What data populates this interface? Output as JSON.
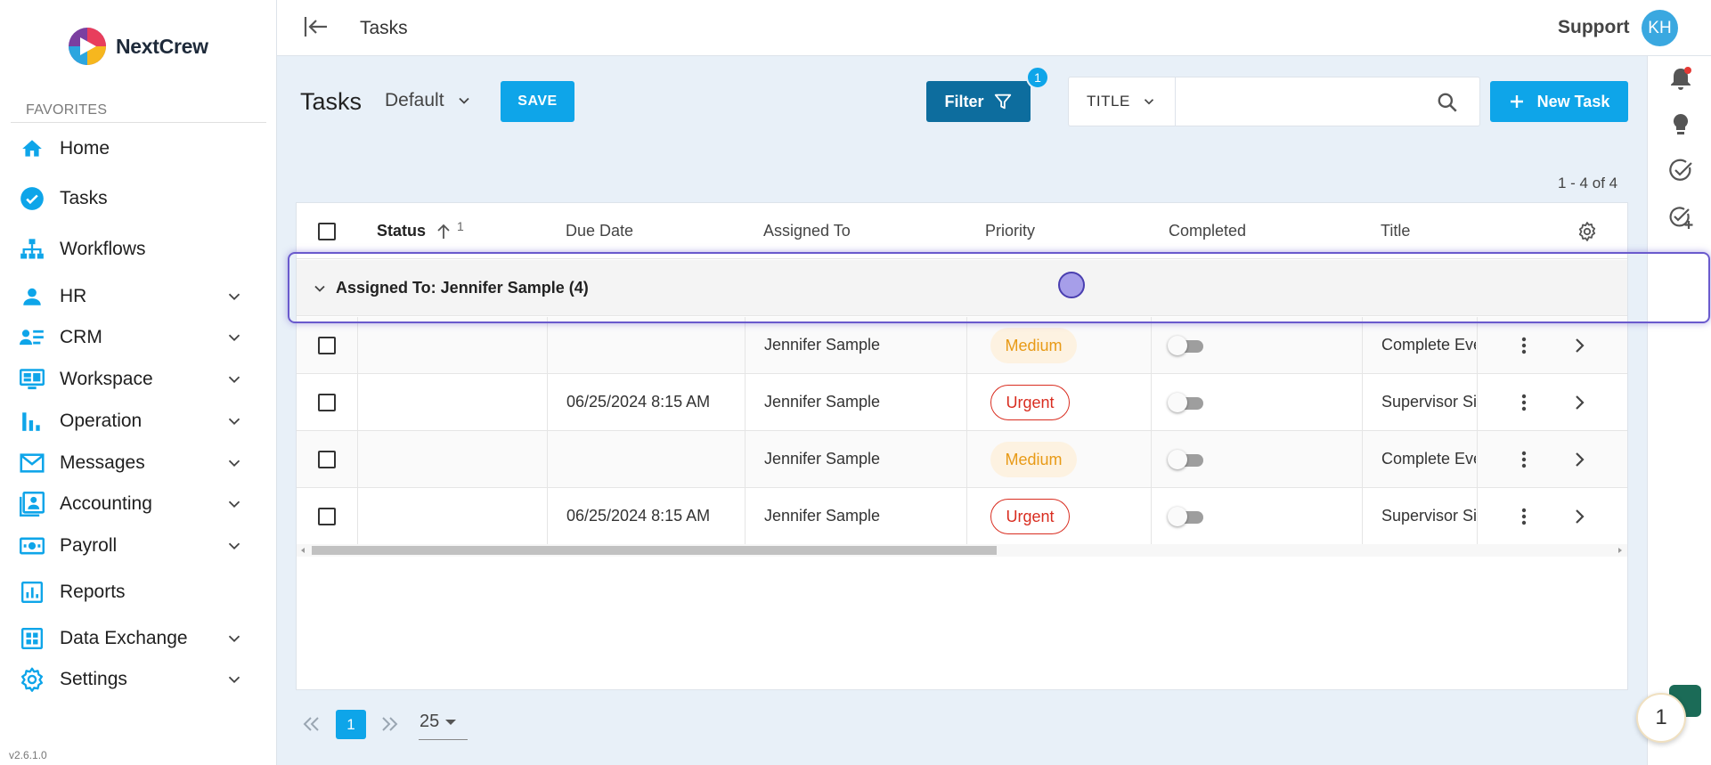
{
  "brand": {
    "name": "NextCrew",
    "version": "v2.6.1.0"
  },
  "sidebar": {
    "favorites_label": "FAVORITES",
    "items": [
      {
        "label": "Home",
        "icon": "home-icon"
      },
      {
        "label": "Tasks",
        "icon": "check-circle-icon"
      },
      {
        "label": "Workflows",
        "icon": "sitemap-icon"
      },
      {
        "label": "HR",
        "icon": "person-icon",
        "expandable": true
      },
      {
        "label": "CRM",
        "icon": "contacts-icon",
        "expandable": true
      },
      {
        "label": "Workspace",
        "icon": "monitor-icon",
        "expandable": true
      },
      {
        "label": "Operation",
        "icon": "bar-chart-icon",
        "expandable": true
      },
      {
        "label": "Messages",
        "icon": "mail-icon",
        "expandable": true
      },
      {
        "label": "Accounting",
        "icon": "account-box-icon",
        "expandable": true
      },
      {
        "label": "Payroll",
        "icon": "money-icon",
        "expandable": true
      },
      {
        "label": "Reports",
        "icon": "report-icon"
      },
      {
        "label": "Data Exchange",
        "icon": "grid-icon",
        "expandable": true
      },
      {
        "label": "Settings",
        "icon": "gear-icon",
        "expandable": true
      }
    ]
  },
  "header": {
    "title": "Tasks",
    "support_label": "Support",
    "avatar_initials": "KH"
  },
  "toolbar": {
    "page_title": "Tasks",
    "view_name": "Default",
    "save_label": "SAVE",
    "filter_label": "Filter",
    "filter_count": "1",
    "search_field": "TITLE",
    "search_placeholder": "",
    "new_task_label": "New Task",
    "range_info": "1 - 4 of 4"
  },
  "grid": {
    "columns": {
      "status": "Status",
      "status_sort_index": "1",
      "due_date": "Due Date",
      "assigned_to": "Assigned To",
      "priority": "Priority",
      "completed": "Completed",
      "title": "Title"
    },
    "group_label": "Assigned To: Jennifer Sample (4)",
    "rows": [
      {
        "status": "",
        "due_date": "",
        "assigned_to": "Jennifer Sample",
        "priority": "Medium",
        "completed": false,
        "title": "Complete Eve"
      },
      {
        "status": "",
        "due_date": "06/25/2024 8:15 AM",
        "assigned_to": "Jennifer Sample",
        "priority": "Urgent",
        "completed": false,
        "title": "Supervisor Si"
      },
      {
        "status": "",
        "due_date": "",
        "assigned_to": "Jennifer Sample",
        "priority": "Medium",
        "completed": false,
        "title": "Complete Eve"
      },
      {
        "status": "",
        "due_date": "06/25/2024 8:15 AM",
        "assigned_to": "Jennifer Sample",
        "priority": "Urgent",
        "completed": false,
        "title": "Supervisor Si"
      }
    ]
  },
  "pagination": {
    "current_page": "1",
    "page_size": "25"
  },
  "chat": {
    "count": "1"
  },
  "colors": {
    "accent": "#0ea5e9",
    "filter": "#0d6d9e",
    "medium": "#e89a16",
    "urgent": "#d92d20",
    "highlight": "#6a5acd"
  }
}
